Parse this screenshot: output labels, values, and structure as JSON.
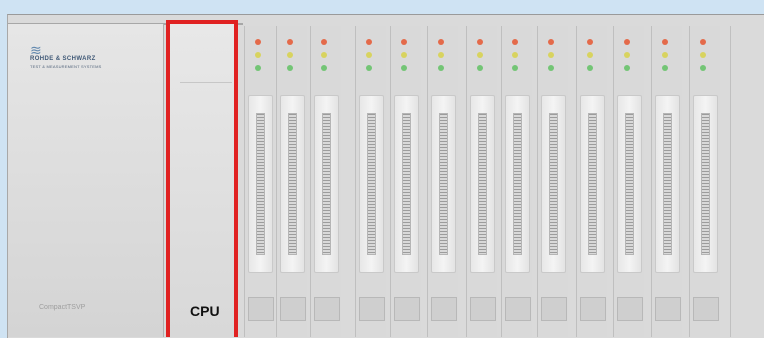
{
  "brand": {
    "logo_wave": "≋",
    "line1": "ROHDE & SCHWARZ",
    "line2": "TEST & MEASUREMENT SYSTEMS"
  },
  "model": {
    "prefix": "CompactTSVP",
    "suffix": "TSVP"
  },
  "cpu_label": "CPU",
  "highlight_color": "#e02121",
  "module_count": 14
}
